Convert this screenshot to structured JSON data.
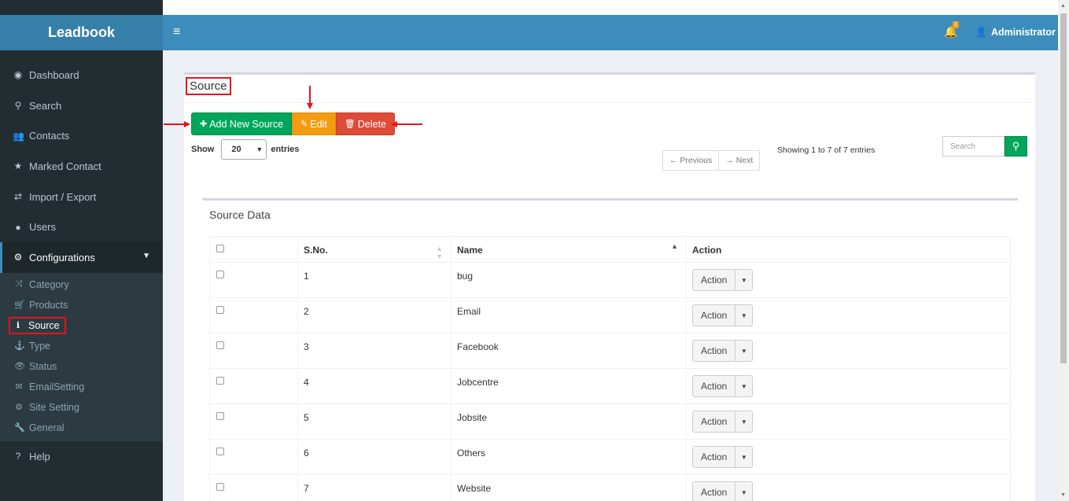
{
  "sidebar": {
    "brand": "Leadbook",
    "items": [
      {
        "label": "Dashboard",
        "icon": "dashboard-icon",
        "glyph": "◉"
      },
      {
        "label": "Search",
        "icon": "search-icon",
        "glyph": "⚲"
      },
      {
        "label": "Contacts",
        "icon": "users-icon",
        "glyph": "👥"
      },
      {
        "label": "Marked Contact",
        "icon": "star-icon",
        "glyph": "★"
      },
      {
        "label": "Import / Export",
        "icon": "exchange-icon",
        "glyph": "⇄"
      },
      {
        "label": "Users",
        "icon": "user-icon",
        "glyph": "●"
      },
      {
        "label": "Configurations",
        "icon": "cogs-icon",
        "glyph": "⚙"
      }
    ],
    "sub_items": [
      {
        "label": "Category",
        "icon": "random-icon",
        "glyph": "⤨"
      },
      {
        "label": "Products",
        "icon": "cart-icon",
        "glyph": "🛒"
      },
      {
        "label": "Source",
        "icon": "info-icon",
        "glyph": "ℹ"
      },
      {
        "label": "Type",
        "icon": "anchor-icon",
        "glyph": "⚓"
      },
      {
        "label": "Status",
        "icon": "eye-icon",
        "glyph": "👁"
      },
      {
        "label": "EmailSetting",
        "icon": "envelope-icon",
        "glyph": "✉"
      },
      {
        "label": "Site Setting",
        "icon": "gear-icon",
        "glyph": "⚙"
      },
      {
        "label": "General",
        "icon": "wrench-icon",
        "glyph": "🔧"
      }
    ],
    "help": {
      "label": "Help",
      "icon": "question-icon",
      "glyph": "?"
    }
  },
  "navbar": {
    "toggle_glyph": "≡",
    "bell_glyph": "🔔",
    "notification_count": "1",
    "user_glyph": "👤",
    "user_name": "Administrator"
  },
  "page": {
    "title": "Source",
    "buttons": {
      "add": "Add New Source",
      "edit": "Edit",
      "delete": "Delete"
    },
    "show_label": "Show",
    "entries_value": "20",
    "entries_label": "entries",
    "prev": "← Previous",
    "next": "→ Next",
    "info": "Showing 1 to 7 of 7 entries",
    "search_placeholder": "Search"
  },
  "panel": {
    "title": "Source Data",
    "columns": [
      "S.No.",
      "Name",
      "Action"
    ],
    "rows": [
      {
        "sno": "1",
        "name": "bug",
        "action": "Action"
      },
      {
        "sno": "2",
        "name": "Email",
        "action": "Action"
      },
      {
        "sno": "3",
        "name": "Facebook",
        "action": "Action"
      },
      {
        "sno": "4",
        "name": "Jobcentre",
        "action": "Action"
      },
      {
        "sno": "5",
        "name": "Jobsite",
        "action": "Action"
      },
      {
        "sno": "6",
        "name": "Others",
        "action": "Action"
      },
      {
        "sno": "7",
        "name": "Website",
        "action": "Action"
      }
    ]
  },
  "colors": {
    "brand": "#367fa9",
    "navbar": "#3c8dbc",
    "sidebar": "#222d32",
    "green": "#00a65a",
    "orange": "#f39c12",
    "red": "#dd4b39",
    "highlight": "#e3141b"
  }
}
